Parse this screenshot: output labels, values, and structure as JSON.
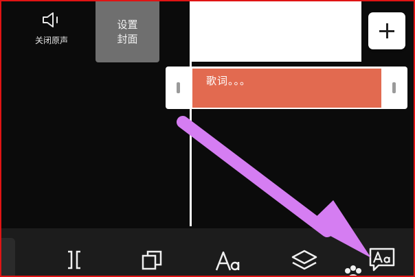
{
  "audio": {
    "mute_label": "关闭原声",
    "icon": "speaker-icon"
  },
  "cover": {
    "line1": "设置",
    "line2": "封面"
  },
  "timeline": {
    "lyric_text": "歌词。。。"
  },
  "add_button": {
    "icon": "plus-icon"
  },
  "toolbar": {
    "items": [
      {
        "icon": "split-icon"
      },
      {
        "icon": "copy-icon"
      },
      {
        "icon": "text-style-icon"
      },
      {
        "icon": "layers-icon"
      },
      {
        "icon": "paw-icon"
      },
      {
        "icon": "text-bubble-icon"
      }
    ]
  },
  "colors": {
    "background": "#0b0b0b",
    "lyric_clip": "#e26a50",
    "frame_border": "#e01414",
    "annotation_arrow": "#d57df2",
    "toolbar": "#1c1c1c"
  }
}
